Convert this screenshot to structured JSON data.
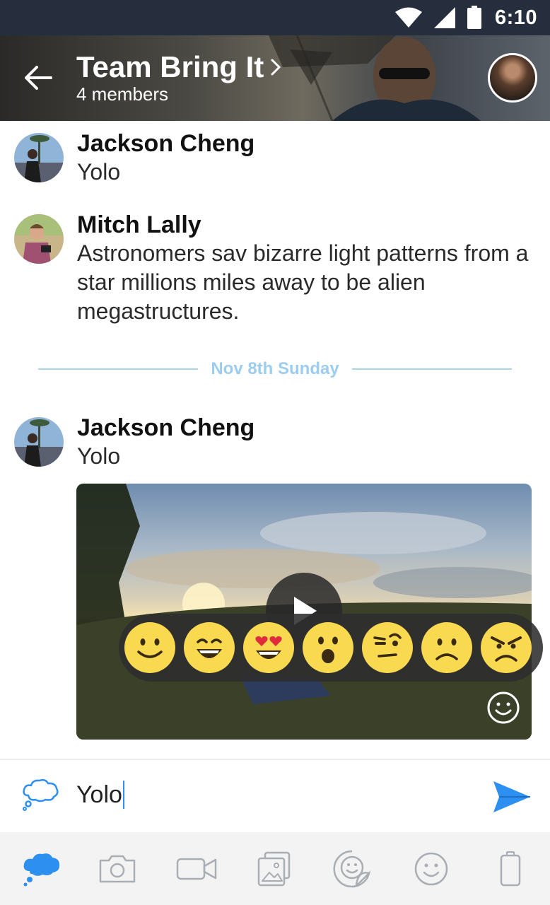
{
  "status_bar": {
    "time": "6:10",
    "icons": [
      "wifi-icon",
      "signal-icon",
      "battery-icon"
    ]
  },
  "header": {
    "title": "Team Bring It",
    "subtitle": "4 members",
    "icons": [
      "back-arrow-icon",
      "chevron-right-icon"
    ]
  },
  "messages": [
    {
      "sender": "Jackson Cheng",
      "text": "Yolo"
    },
    {
      "sender": "Mitch Lally",
      "text": "Astronomers sav bizarre light patterns from a star millions miles away to be alien megastructures."
    },
    {
      "sender": "Jackson Cheng",
      "text": "Yolo"
    }
  ],
  "date_divider": "Nov 8th Sunday",
  "media": {
    "icons": [
      "play-icon",
      "smiley-icon"
    ]
  },
  "reactions": [
    "smile",
    "grin",
    "heart-eyes",
    "surprised",
    "skeptical",
    "sad",
    "angry"
  ],
  "composer": {
    "value": "Yolo",
    "icons": [
      "thought-bubble-icon",
      "send-icon"
    ]
  },
  "toolbar": {
    "items": [
      "chat-icon",
      "camera-icon",
      "video-icon",
      "gallery-icon",
      "sticker-icon",
      "emoji-icon",
      "battery-icon"
    ]
  },
  "colors": {
    "status_bar": "#262d3c",
    "accent": "#2d8ff0",
    "divider": "#9ccdf0",
    "reaction_face": "#f8d94f"
  }
}
